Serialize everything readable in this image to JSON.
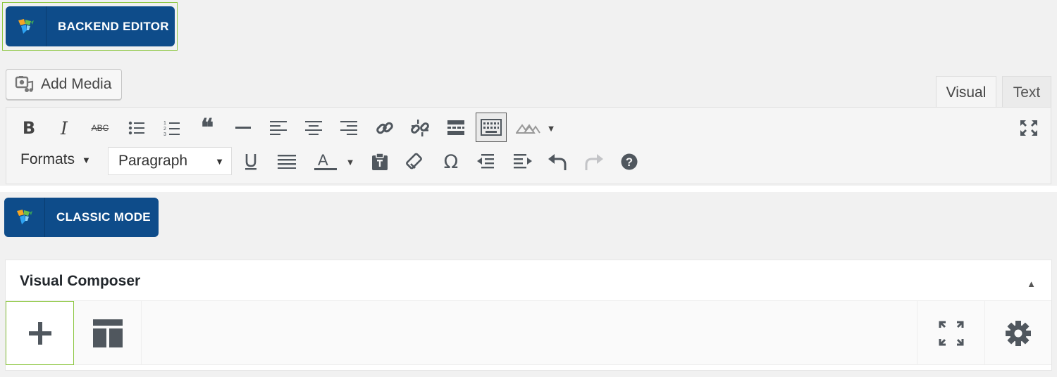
{
  "header": {
    "backend_editor_label": "BACKEND EDITOR"
  },
  "media": {
    "add_media_label": "Add Media"
  },
  "editor_tabs": {
    "visual": "Visual",
    "text": "Text"
  },
  "toolbar": {
    "formats_label": "Formats",
    "paragraph_value": "Paragraph",
    "strikethrough_text": "ABC",
    "row1_icons": [
      "bold-icon",
      "italic-icon",
      "strikethrough-icon",
      "bullet-list-icon",
      "numbered-list-icon",
      "blockquote-icon",
      "horizontal-line-icon",
      "align-left-icon",
      "align-center-icon",
      "align-right-icon",
      "link-icon",
      "unlink-icon",
      "read-more-icon",
      "toolbar-toggle-icon",
      "vc-mountain-icon",
      "fullscreen-icon"
    ],
    "row2_icons": [
      "underline-icon",
      "justify-icon",
      "text-color-icon",
      "paste-text-icon",
      "clear-format-icon",
      "special-char-icon",
      "outdent-icon",
      "indent-icon",
      "undo-icon",
      "redo-icon",
      "help-icon"
    ]
  },
  "classic": {
    "classic_mode_label": "CLASSIC MODE"
  },
  "vc_panel": {
    "title": "Visual Composer",
    "nav_icons": [
      "add-element-icon",
      "templates-icon",
      "fullscreen-icon",
      "settings-icon"
    ]
  },
  "colors": {
    "vc_blue": "#0e4c8a",
    "focus_green": "#8cc63f",
    "icon_gray": "#50575e"
  }
}
